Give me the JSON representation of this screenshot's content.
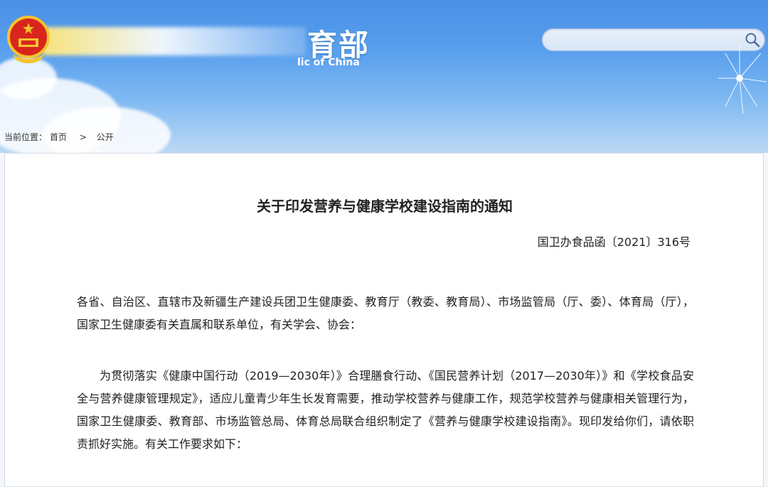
{
  "header": {
    "ministry_name": "育部",
    "ministry_en": "lic of China",
    "search": {
      "placeholder": ""
    }
  },
  "breadcrumb": {
    "prefix": "当前位置：",
    "home": "首页",
    "separator": ">",
    "current": "公开"
  },
  "article": {
    "title": "关于印发营养与健康学校建设指南的通知",
    "doc_number": "国卫办食品函〔2021〕316号",
    "addressee": "各省、自治区、直辖市及新疆生产建设兵团卫生健康委、教育厅（教委、教育局）、市场监管局（厅、委）、体育局（厅），国家卫生健康委有关直属和联系单位，有关学会、协会：",
    "body": "为贯彻落实《健康中国行动（2019—2030年）》合理膳食行动、《国民营养计划（2017—2030年）》和《学校食品安全与营养健康管理规定》，适应儿童青少年生长发育需要，推动学校营养与健康工作，规范学校营养与健康相关管理行为，国家卫生健康委、教育部、市场监管总局、体育总局联合组织制定了《营养与健康学校建设指南》。现印发给你们，请依职责抓好实施。有关工作要求如下："
  }
}
